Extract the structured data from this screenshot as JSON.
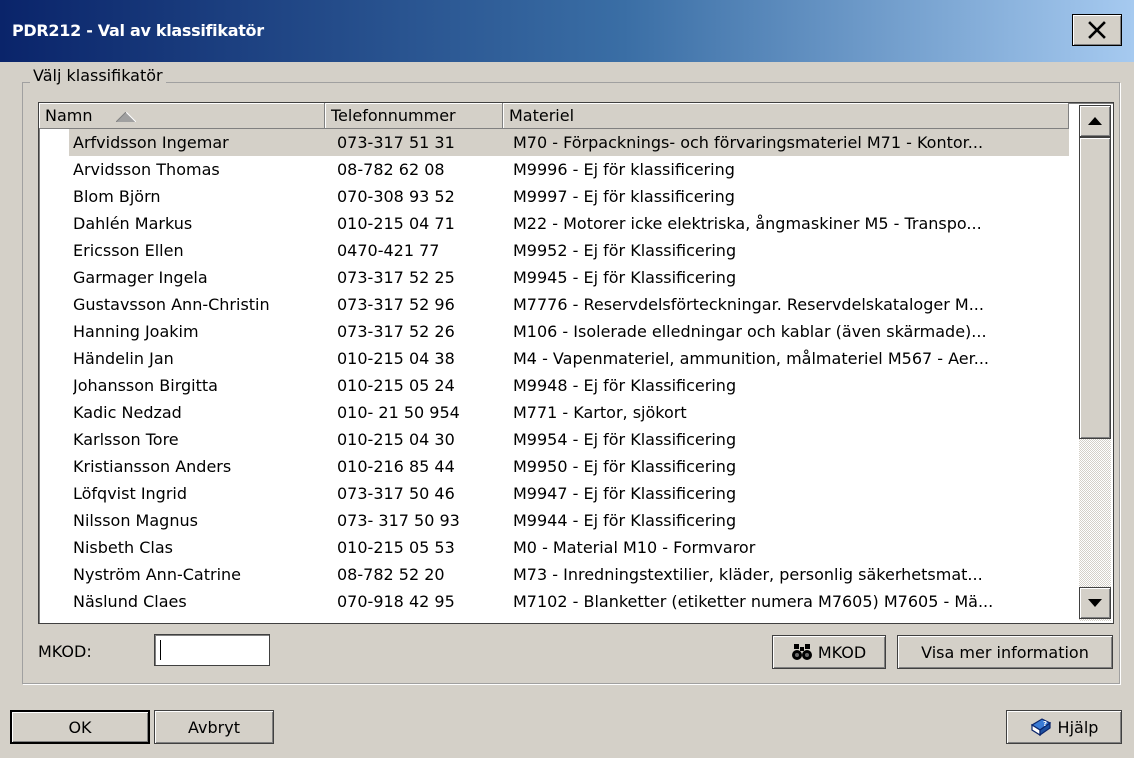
{
  "window": {
    "title": "PDR212 - Val av klassifikatör",
    "close_label": "X"
  },
  "group": {
    "label": "Välj klassifikatör"
  },
  "table": {
    "columns": [
      "Namn",
      "Telefonnummer",
      "Materiel"
    ],
    "sort_column": "Namn",
    "sort_direction": "ascending",
    "selected_index": 0,
    "rows": [
      {
        "name": "Arfvidsson Ingemar",
        "phone": "073-317 51 31",
        "material": "M70 - Förpacknings- och förvaringsmateriel M71 - Kontor..."
      },
      {
        "name": "Arvidsson Thomas",
        "phone": "08-782 62 08",
        "material": "M9996 - Ej för klassificering"
      },
      {
        "name": "Blom Björn",
        "phone": "070-308 93 52",
        "material": "M9997 - Ej för klassificering"
      },
      {
        "name": "Dahlén Markus",
        "phone": "010-215 04 71",
        "material": "M22 - Motorer icke elektriska, ångmaskiner M5 - Transpo..."
      },
      {
        "name": "Ericsson Ellen",
        "phone": "0470-421 77",
        "material": "M9952 - Ej för Klassificering"
      },
      {
        "name": "Garmager Ingela",
        "phone": "073-317 52 25",
        "material": "M9945 - Ej för Klassificering"
      },
      {
        "name": "Gustavsson Ann-Christin",
        "phone": "073-317 52 96",
        "material": "M7776 - Reservdelsförteckningar. Reservdelskataloger M..."
      },
      {
        "name": "Hanning Joakim",
        "phone": "073-317 52 26",
        "material": "M106 - Isolerade elledningar och kablar (även skärmade)..."
      },
      {
        "name": "Händelin Jan",
        "phone": "010-215 04 38",
        "material": "M4 - Vapenmateriel, ammunition, målmateriel M567 - Aer..."
      },
      {
        "name": "Johansson Birgitta",
        "phone": "010-215 05 24",
        "material": "M9948 - Ej för Klassificering"
      },
      {
        "name": "Kadic Nedzad",
        "phone": "010- 21 50 954",
        "material": "M771 - Kartor, sjökort"
      },
      {
        "name": "Karlsson Tore",
        "phone": "010-215 04 30",
        "material": "M9954 - Ej för Klassificering"
      },
      {
        "name": "Kristiansson Anders",
        "phone": "010-216 85 44",
        "material": "M9950 - Ej för Klassificering"
      },
      {
        "name": "Löfqvist Ingrid",
        "phone": "073-317 50 46",
        "material": "M9947 - Ej för Klassificering"
      },
      {
        "name": "Nilsson Magnus",
        "phone": "073- 317 50 93",
        "material": "M9944 - Ej för Klassificering"
      },
      {
        "name": "Nisbeth Clas",
        "phone": "010-215 05 53",
        "material": "M0 - Material M10 - Formvaror"
      },
      {
        "name": "Nyström Ann-Catrine",
        "phone": "08-782 52 20",
        "material": "M73 - Inredningstextilier, kläder, personlig säkerhetsmat..."
      },
      {
        "name": "Näslund Claes",
        "phone": "070-918 42 95",
        "material": "M7102 - Blanketter (etiketter numera M7605) M7605 - Mä..."
      }
    ]
  },
  "mkod": {
    "label": "MKOD:",
    "value": "",
    "search_button_label": "MKOD",
    "search_button_icon": "binoculars-icon",
    "more_info_label": "Visa mer information"
  },
  "footer": {
    "ok_label": "OK",
    "cancel_label": "Avbryt",
    "help_label": "Hjälp",
    "help_icon": "help-book-icon"
  },
  "colors": {
    "titlebar_start": "#0a246a",
    "titlebar_end": "#a6caf0",
    "dialog_bg": "#d4d0c8",
    "selected_row_bg": "#d4d0c8"
  }
}
